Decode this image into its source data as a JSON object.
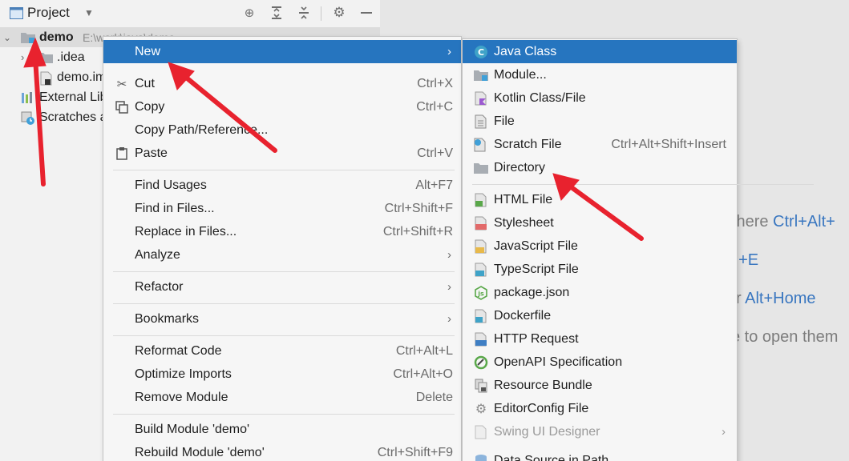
{
  "project": {
    "title": "Project",
    "tree": [
      {
        "name": "demo",
        "path": "E:\\work\\java\\demo"
      },
      {
        "name": ".idea"
      },
      {
        "name": "demo.iml"
      },
      {
        "name": "External Libraries"
      },
      {
        "name": "Scratches and Consoles"
      }
    ]
  },
  "menu": {
    "items": [
      {
        "label": "New",
        "shortcut": "",
        "submenu": true
      },
      {
        "label": "Cut",
        "shortcut": "Ctrl+X",
        "icon": "scissors-icon"
      },
      {
        "label": "Copy",
        "shortcut": "Ctrl+C",
        "icon": "copy-icon"
      },
      {
        "label": "Copy Path/Reference...",
        "shortcut": ""
      },
      {
        "label": "Paste",
        "shortcut": "Ctrl+V",
        "icon": "clipboard-icon"
      },
      {
        "label": "Find Usages",
        "shortcut": "Alt+F7"
      },
      {
        "label": "Find in Files...",
        "shortcut": "Ctrl+Shift+F"
      },
      {
        "label": "Replace in Files...",
        "shortcut": "Ctrl+Shift+R"
      },
      {
        "label": "Analyze",
        "shortcut": "",
        "submenu": true
      },
      {
        "label": "Refactor",
        "shortcut": "",
        "submenu": true
      },
      {
        "label": "Bookmarks",
        "shortcut": "",
        "submenu": true
      },
      {
        "label": "Reformat Code",
        "shortcut": "Ctrl+Alt+L"
      },
      {
        "label": "Optimize Imports",
        "shortcut": "Ctrl+Alt+O"
      },
      {
        "label": "Remove Module",
        "shortcut": "Delete"
      },
      {
        "label": "Build Module 'demo'",
        "shortcut": ""
      },
      {
        "label": "Rebuild Module 'demo'",
        "shortcut": "Ctrl+Shift+F9"
      }
    ]
  },
  "submenu": {
    "items": [
      {
        "label": "Java Class",
        "shortcut": ""
      },
      {
        "label": "Module...",
        "shortcut": ""
      },
      {
        "label": "Kotlin Class/File",
        "shortcut": ""
      },
      {
        "label": "File",
        "shortcut": ""
      },
      {
        "label": "Scratch File",
        "shortcut": "Ctrl+Alt+Shift+Insert"
      },
      {
        "label": "Directory",
        "shortcut": ""
      },
      {
        "label": "HTML File",
        "shortcut": "",
        "badge": "H"
      },
      {
        "label": "Stylesheet",
        "shortcut": "",
        "badge": "CSS"
      },
      {
        "label": "JavaScript File",
        "shortcut": "",
        "badge": "JS"
      },
      {
        "label": "TypeScript File",
        "shortcut": "",
        "badge": "TS"
      },
      {
        "label": "package.json",
        "shortcut": ""
      },
      {
        "label": "Dockerfile",
        "shortcut": "",
        "badge": "D"
      },
      {
        "label": "HTTP Request",
        "shortcut": "",
        "badge": "API"
      },
      {
        "label": "OpenAPI Specification",
        "shortcut": ""
      },
      {
        "label": "Resource Bundle",
        "shortcut": ""
      },
      {
        "label": "EditorConfig File",
        "shortcut": ""
      },
      {
        "label": "Swing UI Designer",
        "shortcut": "",
        "disabled": true
      },
      {
        "label": "Data Source in Path",
        "shortcut": ""
      }
    ]
  },
  "editor_hints": [
    {
      "text": "where ",
      "key": "Ctrl+Alt+"
    },
    {
      "text": "",
      "key": "rl+E"
    },
    {
      "text": "r ",
      "key": "Alt+Home"
    },
    {
      "text": "e to open them",
      "key": ""
    }
  ],
  "colors": {
    "selection": "#2675bf",
    "annotation_arrow": "#e8222e",
    "hint_key": "#3a77c0"
  }
}
